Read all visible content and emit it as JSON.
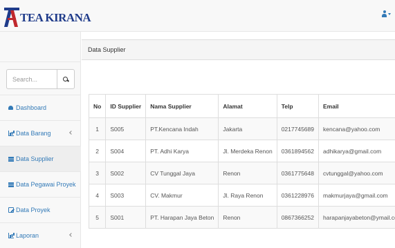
{
  "header": {
    "brand_text": "TEA KIRANA",
    "brand_color": "#1f3b8a",
    "brand_accent": "#c0282d",
    "user_icon": "user-icon",
    "caret_icon": "caret-down-icon"
  },
  "sidebar": {
    "search": {
      "placeholder": "Search...",
      "icon": "search-icon"
    },
    "items": [
      {
        "label": "Dashboard",
        "icon": "dashboard-icon",
        "has_arrow": false,
        "active": false
      },
      {
        "label": "Data Barang",
        "icon": "bar-chart-icon",
        "has_arrow": true,
        "active": false
      },
      {
        "label": "Data Supplier",
        "icon": "list-icon",
        "has_arrow": false,
        "active": true
      },
      {
        "label": "Data Pegawai Proyek",
        "icon": "list-icon",
        "has_arrow": false,
        "active": false
      },
      {
        "label": "Data Proyek",
        "icon": "edit-icon",
        "has_arrow": false,
        "active": false
      },
      {
        "label": "Laporan",
        "icon": "bar-chart-icon",
        "has_arrow": true,
        "active": false
      }
    ]
  },
  "main": {
    "panel_title": "Data Supplier",
    "table": {
      "columns": [
        "No",
        "ID Supplier",
        "Nama Supplier",
        "Alamat",
        "Telp",
        "Email"
      ],
      "rows": [
        [
          "1",
          "S005",
          "PT.Kencana Indah",
          "Jakarta",
          "0217745689",
          "kencana@yahoo.com"
        ],
        [
          "2",
          "S004",
          "PT. Adhi Karya",
          "Jl. Merdeka Renon",
          "0361894562",
          "adhikarya@gmail.com"
        ],
        [
          "3",
          "S002",
          "CV Tunggal Jaya",
          "Renon",
          "0361775648",
          "cvtunggal@yahoo.com"
        ],
        [
          "4",
          "S003",
          "CV. Makmur",
          "Jl. Raya Renon",
          "0361228976",
          "makmurjaya@gmail.com"
        ],
        [
          "5",
          "S001",
          "PT. Harapan Jaya Beton",
          "Renon",
          "0867366252",
          "harapanjayabeton@ymail.com"
        ]
      ]
    }
  },
  "colors": {
    "link": "#337ab7",
    "sidebar_bg": "#f8f8f8",
    "border": "#dddddd",
    "stripe": "#f9f9f9",
    "active_bg": "#eeeeee"
  }
}
